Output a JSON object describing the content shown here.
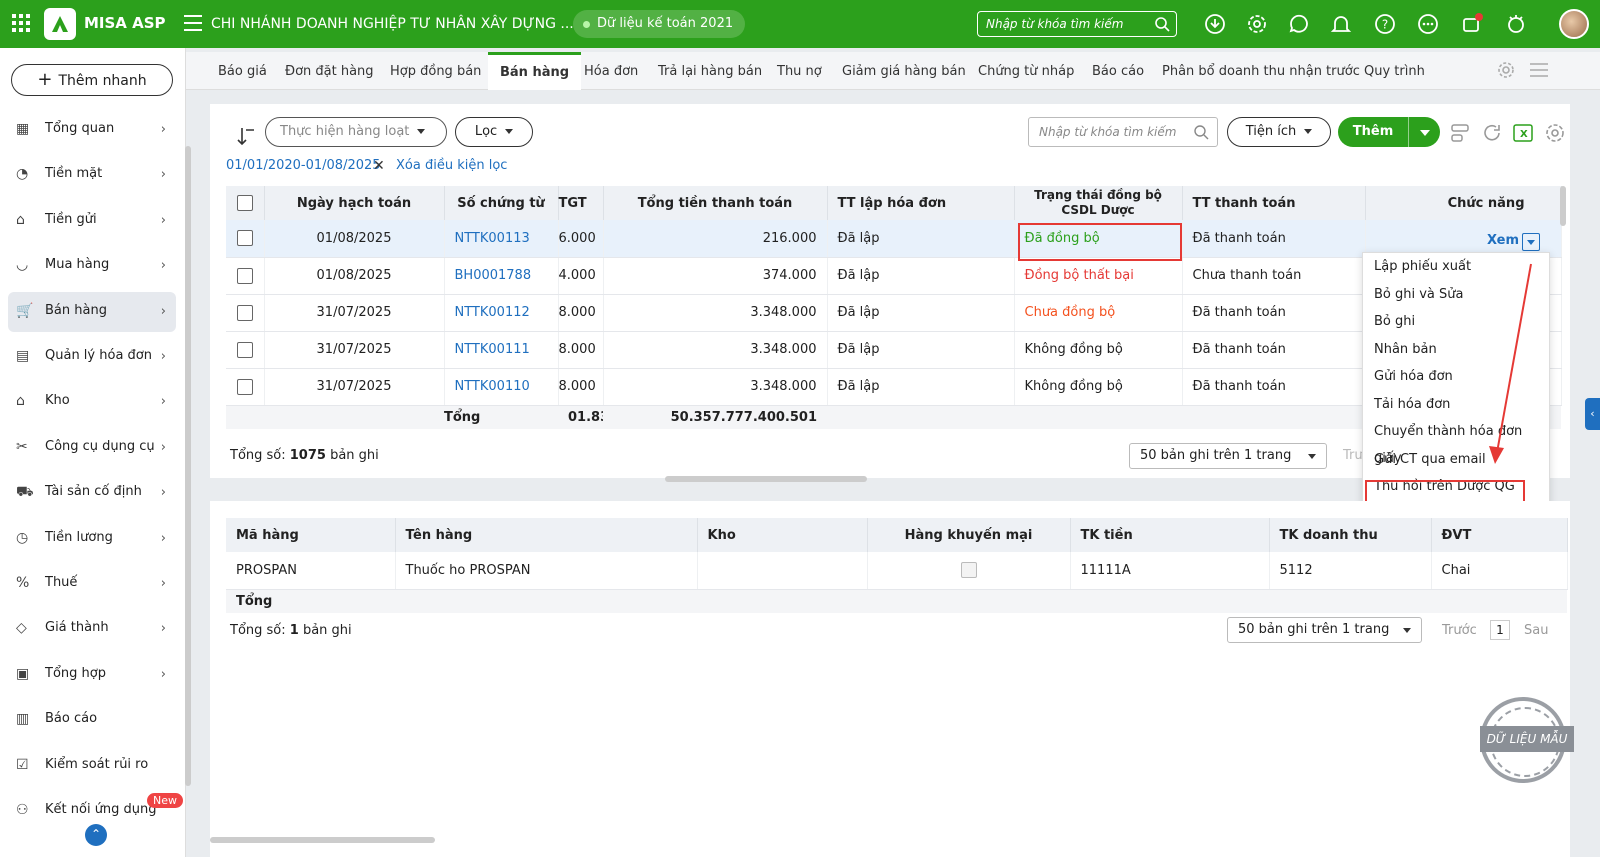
{
  "topbar": {
    "logo": "MISA ASP",
    "company": "CHI NHÁNH DOANH NGHIỆP TƯ NHÂN XÂY DỰNG ...",
    "data_label": "Dữ liệu kế toán 2021",
    "search_placeholder": "Nhập từ khóa tìm kiếm",
    "icons": [
      "download-icon",
      "settings-icon",
      "chat-icon",
      "bell-icon",
      "help-icon",
      "more-icon",
      "notification-icon",
      "support-icon"
    ]
  },
  "sidebar": {
    "quick_add": "Thêm nhanh",
    "items": [
      {
        "label": "Tổng quan",
        "icon": "dashboard-icon"
      },
      {
        "label": "Tiền mặt",
        "icon": "cash-icon"
      },
      {
        "label": "Tiền gửi",
        "icon": "bank-icon"
      },
      {
        "label": "Mua hàng",
        "icon": "purchase-icon"
      },
      {
        "label": "Bán hàng",
        "icon": "cart-icon"
      },
      {
        "label": "Quản lý hóa đơn",
        "icon": "invoice-icon"
      },
      {
        "label": "Kho",
        "icon": "warehouse-icon"
      },
      {
        "label": "Công cụ dụng cụ",
        "icon": "tools-icon"
      },
      {
        "label": "Tài sản cố định",
        "icon": "asset-icon"
      },
      {
        "label": "Tiền lương",
        "icon": "salary-icon"
      },
      {
        "label": "Thuế",
        "icon": "tax-icon"
      },
      {
        "label": "Giá thành",
        "icon": "price-tag-icon"
      },
      {
        "label": "Tổng hợp",
        "icon": "summary-icon"
      },
      {
        "label": "Báo cáo",
        "icon": "report-icon"
      },
      {
        "label": "Kiểm soát rủi ro",
        "icon": "risk-icon"
      },
      {
        "label": "Kết nối ứng dụng",
        "icon": "plug-icon"
      }
    ],
    "new_badge": "New"
  },
  "tabs": [
    "Báo giá",
    "Đơn đặt hàng",
    "Hợp đồng bán",
    "Bán hàng",
    "Hóa đơn",
    "Trả lại hàng bán",
    "Thu nợ",
    "Giảm giá hàng bán",
    "Chứng từ nháp",
    "Báo cáo",
    "Phân bổ doanh thu nhận trước",
    "Quy trình"
  ],
  "toolbar": {
    "bulk_action": "Thực hiện hàng loạt",
    "filter": "Lọc",
    "search_placeholder": "Nhập từ khóa tìm kiếm",
    "utility": "Tiện ích",
    "add": "Thêm"
  },
  "filter_bar": {
    "range": "01/01/2020-01/08/2025",
    "clear": "Xóa điều kiện lọc"
  },
  "main_table": {
    "headers": [
      "Ngày hạch toán",
      "Số chứng từ",
      "TGT",
      "Tổng tiền thanh toán",
      "TT lập hóa đơn",
      "Trạng thái đồng bộ CSDL Dược",
      "TT thanh toán",
      "Chức năng"
    ],
    "rows": [
      {
        "date": "01/08/2025",
        "doc": "NTTK00113",
        "tgt": "6.000",
        "total": "216.000",
        "invoice": "Đã lập",
        "sync": "Đã đồng bộ",
        "pay": "Đã thanh toán"
      },
      {
        "date": "01/08/2025",
        "doc": "BH0001788",
        "tgt": "4.000",
        "total": "374.000",
        "invoice": "Đã lập",
        "sync": "Đồng bộ thất bại",
        "pay": "Chưa thanh toán"
      },
      {
        "date": "31/07/2025",
        "doc": "NTTK00112",
        "tgt": "8.000",
        "total": "3.348.000",
        "invoice": "Đã lập",
        "sync": "Chưa đồng bộ",
        "pay": "Đã thanh toán"
      },
      {
        "date": "31/07/2025",
        "doc": "NTTK00111",
        "tgt": "8.000",
        "total": "3.348.000",
        "invoice": "Đã lập",
        "sync": "Không đồng bộ",
        "pay": "Đã thanh toán"
      },
      {
        "date": "31/07/2025",
        "doc": "NTTK00110",
        "tgt": "8.000",
        "total": "3.348.000",
        "invoice": "Đã lập",
        "sync": "Không đồng bộ",
        "pay": "Đã thanh toán"
      }
    ],
    "total_label": "Tổng",
    "total_tgt": "01.831",
    "total_amount": "50.357.777.400.501",
    "view_label": "Xem",
    "record_prefix": "Tổng số:",
    "record_count": "1075",
    "record_suffix": "bản ghi",
    "page_size": "50 bản ghi trên 1 trang",
    "prev_partial": "Trư"
  },
  "context_menu": [
    "Lập phiếu xuất",
    "Bỏ ghi và Sửa",
    "Bỏ ghi",
    "Nhân bản",
    "Gửi hóa đơn",
    "Tải hóa đơn",
    "Chuyển thành hóa đơn giấy",
    "Gửi CT qua email",
    "Thu hồi trên Dược QG"
  ],
  "detail_table": {
    "headers": [
      "Mã hàng",
      "Tên hàng",
      "Kho",
      "Hàng khuyến mại",
      "TK tiền",
      "TK doanh thu",
      "ĐVT"
    ],
    "rows": [
      {
        "code": "PROSPAN",
        "name": "Thuốc ho PROSPAN",
        "warehouse": "",
        "tk_tien": "11111A",
        "tk_dt": "5112",
        "unit": "Chai"
      }
    ],
    "total_label": "Tổng",
    "record_prefix": "Tổng số:",
    "record_count": "1",
    "record_suffix": "bản ghi",
    "page_size": "50 bản ghi trên 1 trang",
    "prev": "Trước",
    "page": "1",
    "next": "Sau"
  },
  "stamp_text": "DỮ LIỆU MẪU",
  "colors": {
    "brand": "#2ca01c",
    "link": "#1f6fbf",
    "alert": "#e53935"
  }
}
